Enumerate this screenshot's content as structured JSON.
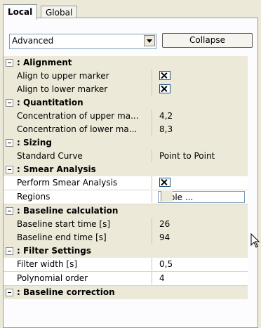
{
  "tabs": [
    "Local",
    "Global"
  ],
  "view_mode": "Advanced",
  "collapse_label": "Collapse",
  "sections": [
    {
      "title": ": Alignment",
      "rows": [
        {
          "label": "Align to upper marker",
          "type": "check",
          "checked": true
        },
        {
          "label": "Align to lower marker",
          "type": "check",
          "checked": true
        }
      ]
    },
    {
      "title": ": Quantitation",
      "rows": [
        {
          "label": "Concentration of upper ma...",
          "type": "text",
          "value": "4,2"
        },
        {
          "label": "Concentration of lower ma...",
          "type": "text",
          "value": "8,3"
        }
      ]
    },
    {
      "title": ": Sizing",
      "rows": [
        {
          "label": "Standard Curve",
          "type": "text",
          "value": "Point to Point"
        }
      ]
    },
    {
      "title": ": Smear Analysis",
      "rows": [
        {
          "label": "Perform Smear Analysis",
          "type": "check",
          "checked": true,
          "editable": true
        },
        {
          "label": "Regions",
          "type": "button",
          "value": "Table ...",
          "editable": true
        }
      ]
    },
    {
      "title": ": Baseline calculation",
      "rows": [
        {
          "label": "Baseline start time [s]",
          "type": "text",
          "value": "26"
        },
        {
          "label": "Baseline end time [s]",
          "type": "text",
          "value": "94"
        }
      ]
    },
    {
      "title": ": Filter Settings",
      "rows": [
        {
          "label": "Filter width [s]",
          "type": "text",
          "value": "0,5",
          "editable": true
        },
        {
          "label": "Polynomial order",
          "type": "text",
          "value": "4",
          "editable": true
        }
      ]
    },
    {
      "title": ": Baseline correction",
      "rows": []
    }
  ],
  "icons": {
    "toggle": "collapse-minus-icon",
    "check": "checkbox-checked-icon",
    "dropdown": "dropdown-arrow-icon",
    "cursor": "mouse-pointer-icon"
  },
  "colors": {
    "panel_bg": "#ece9d8",
    "border": "#919b9c",
    "white": "#ffffff"
  }
}
